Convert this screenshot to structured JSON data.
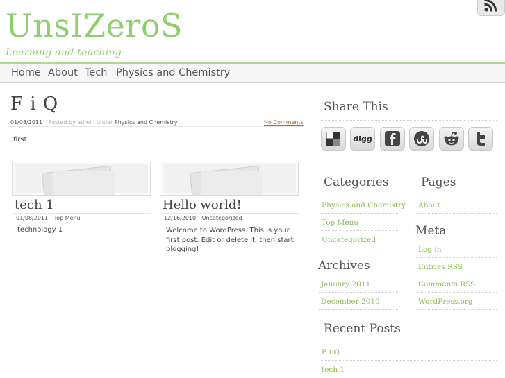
{
  "header": {
    "site_title": "UnsIZeroS",
    "tagline": "Learning and teaching"
  },
  "nav": {
    "items": [
      {
        "label": "Home"
      },
      {
        "label": "About"
      },
      {
        "label": "Tech"
      },
      {
        "label": "Physics and Chemistry"
      }
    ]
  },
  "post": {
    "title": "F i Q",
    "date": "01/08/2011",
    "posted_by": "Posted by admin under",
    "category": "Physics and Chemistry",
    "comments": "No Comments",
    "body": "first"
  },
  "related": [
    {
      "title": "tech 1",
      "date": "01/08/2011",
      "category": "Top Menu",
      "excerpt": "technology 1"
    },
    {
      "title": "Hello world!",
      "date": "12/16/2010",
      "category": "Uncategorized",
      "excerpt": "Welcome to WordPress. This is your first post. Edit or delete it, then start blogging!"
    }
  ],
  "sidebar": {
    "share_heading": "Share This",
    "share_buttons": [
      "delicious-icon",
      "digg-icon",
      "facebook-icon",
      "stumbleupon-icon",
      "reddit-icon",
      "twitter-icon"
    ],
    "digg_text": "digg",
    "categories_heading": "Categories",
    "categories": [
      "Physics and Chemistry",
      "Top Menu",
      "Uncategorized"
    ],
    "pages_heading": "Pages",
    "pages": [
      "About"
    ],
    "meta_heading": "Meta",
    "meta": [
      "Log in",
      "Entries RSS",
      "Comments RSS",
      "WordPress.org"
    ],
    "archives_heading": "Archives",
    "archives": [
      "January 2011",
      "December 2010"
    ],
    "recent_heading": "Recent Posts",
    "recent": [
      "F i Q",
      "tech 1"
    ]
  },
  "colors": {
    "accent": "#8fcf6f",
    "link": "#8bbd5a"
  }
}
